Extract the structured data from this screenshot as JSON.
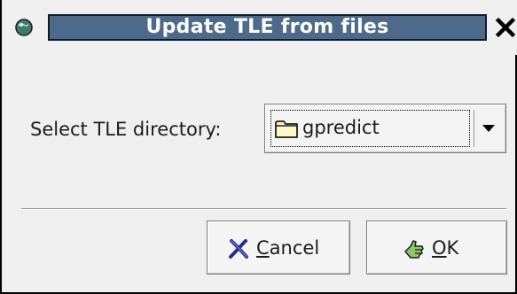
{
  "window": {
    "title": "Update TLE from files",
    "title_bar_color": "#4d6a8a",
    "app_icon": "globe-icon",
    "close_icon": "close-icon"
  },
  "form": {
    "directory_label": "Select TLE directory:",
    "directory_value": "gpredict",
    "directory_icon": "folder-icon",
    "dropdown_icon": "chevron-down-icon"
  },
  "buttons": {
    "cancel": {
      "mnemonic": "C",
      "rest": "ancel",
      "icon": "cancel-x-icon",
      "icon_color": "#2a2e8a"
    },
    "ok": {
      "mnemonic": "O",
      "rest": "K",
      "icon": "ok-hand-icon",
      "icon_color": "#5a8a3a"
    }
  }
}
